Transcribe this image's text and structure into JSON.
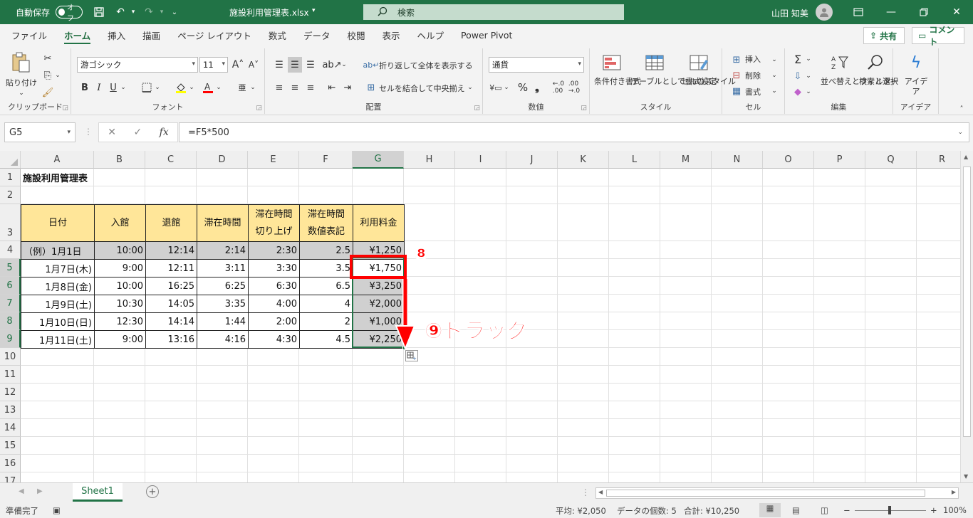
{
  "titlebar": {
    "autosave_label": "自動保存",
    "autosave_state": "オフ",
    "file_name": "施設利用管理表.xlsx",
    "search_placeholder": "検索",
    "user_name": "山田 知美"
  },
  "menu": {
    "tabs": [
      "ファイル",
      "ホーム",
      "挿入",
      "描画",
      "ページ レイアウト",
      "数式",
      "データ",
      "校閲",
      "表示",
      "ヘルプ",
      "Power Pivot"
    ],
    "share_label": "共有",
    "comment_label": "コメント"
  },
  "ribbon": {
    "clipboard": {
      "label": "クリップボード",
      "paste_label": "貼り付け"
    },
    "font": {
      "label": "フォント",
      "font_name": "游ゴシック",
      "font_size": "11",
      "bold": "B",
      "italic": "I",
      "underline": "U"
    },
    "align": {
      "label": "配置",
      "wrap_text": "折り返して全体を表示する",
      "merge_center": "セルを結合して中央揃え"
    },
    "number": {
      "label": "数値",
      "format": "通貨"
    },
    "styles": {
      "label": "スタイル",
      "conditional": "条件付き書式",
      "as_table": "テーブルとして書式設定",
      "cell_styles": "セルのスタイル"
    },
    "cells": {
      "label": "セル",
      "insert": "挿入",
      "delete": "削除",
      "format": "書式"
    },
    "edit": {
      "label": "編集",
      "sort_filter": "並べ替えとフィルター",
      "find_select": "検索と選択"
    },
    "ideas": {
      "label": "アイデア",
      "ideas_btn": "アイデア"
    }
  },
  "formula_bar": {
    "name_box": "G5",
    "formula": "=F5*500"
  },
  "grid": {
    "columns": [
      "A",
      "B",
      "C",
      "D",
      "E",
      "F",
      "G",
      "H",
      "I",
      "J",
      "K",
      "L",
      "M",
      "N",
      "O",
      "P",
      "Q",
      "R"
    ],
    "rows": [
      "1",
      "2",
      "3",
      "4",
      "5",
      "6",
      "7",
      "8",
      "9",
      "10",
      "11",
      "12",
      "13",
      "14",
      "15",
      "16",
      "17"
    ],
    "title_cell": "施設利用管理表",
    "headers": [
      "日付",
      "入館",
      "退館",
      "滞在時間",
      "滞在時間\n切り上げ",
      "滞在時間\n数値表記",
      "利用料金"
    ],
    "data_rows": [
      [
        "（例）1月1日",
        "10:00",
        "12:14",
        "2:14",
        "2:30",
        "2.5",
        "¥1,250"
      ],
      [
        "1月7日(木)",
        "9:00",
        "12:11",
        "3:11",
        "3:30",
        "3.5",
        "¥1,750"
      ],
      [
        "1月8日(金)",
        "10:00",
        "16:25",
        "6:25",
        "6:30",
        "6.5",
        "¥3,250"
      ],
      [
        "1月9日(土)",
        "10:30",
        "14:05",
        "3:35",
        "4:00",
        "4",
        "¥2,000"
      ],
      [
        "1月10日(日)",
        "12:30",
        "14:14",
        "1:44",
        "2:00",
        "2",
        "¥1,000"
      ],
      [
        "1月11日(土)",
        "9:00",
        "13:16",
        "4:16",
        "4:30",
        "4.5",
        "¥2,250"
      ]
    ]
  },
  "annotations": {
    "step8": "⑧",
    "step9": "⑨ドラッグ",
    "color": "#ff0000"
  },
  "sheets": {
    "active": "Sheet1"
  },
  "status": {
    "ready": "準備完了",
    "average": "平均: ¥2,050",
    "count": "データの個数: 5",
    "sum": "合計: ¥10,250",
    "zoom": "100%"
  },
  "colors": {
    "brand": "#217346",
    "header_fill": "#ffe699"
  }
}
